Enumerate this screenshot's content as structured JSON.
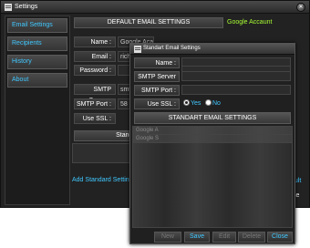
{
  "window": {
    "title": "Settings"
  },
  "sidebar": {
    "items": [
      {
        "label": "Email Settings"
      },
      {
        "label": "Recipients"
      },
      {
        "label": "History"
      },
      {
        "label": "About"
      }
    ]
  },
  "main": {
    "section_title": "DEFAULT EMAIL SETTINGS",
    "side_label": "Google Accaunt",
    "fields": {
      "name_label": "Name :",
      "name_value": "Google Acaunt",
      "email_label": "Email :",
      "email_value": "rich",
      "password_label": "Password :",
      "password_value": "",
      "smtp_server_label": "SMTP Server :",
      "smtp_server_value": "smt",
      "smtp_port_label": "SMTP Port :",
      "smtp_port_value": "58",
      "use_ssl_label": "Use SSL :"
    },
    "standard_header_fragment": "Stanc",
    "add_standard_fragment": "Add Standard Setting",
    "right_fragment_1": "ault",
    "right_fragment_2": "se"
  },
  "dialog": {
    "title": "Standart Email Settings",
    "name_label": "Name :",
    "smtp_server_label": "SMTP Server :",
    "smtp_port_label": "SMTP Port :",
    "use_ssl_label": "Use SSL :",
    "ssl_yes": "Yes",
    "ssl_no": "No",
    "list_title": "STANDART EMAIL SETTINGS",
    "list_rows": [
      "Google A",
      "Google S"
    ],
    "buttons": {
      "new": "New",
      "save": "Save",
      "edit": "Edit",
      "delete": "Delete",
      "close": "Close"
    }
  },
  "colors": {
    "accent": "#40c8ff",
    "google_label": "#aaff33"
  }
}
